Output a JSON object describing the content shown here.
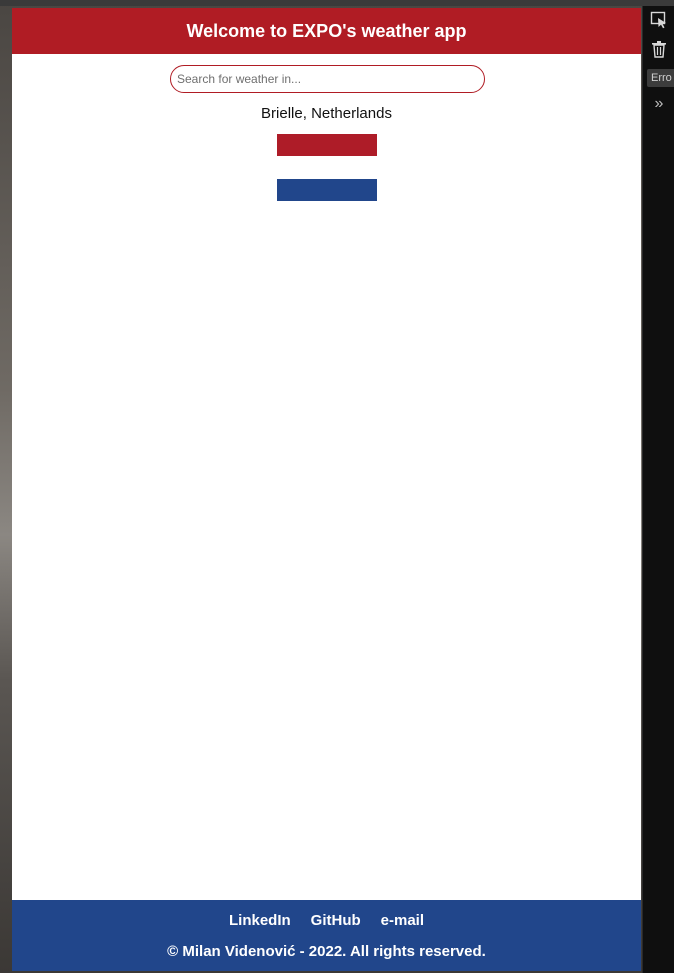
{
  "header": {
    "title": "Welcome to EXPO's weather app"
  },
  "search": {
    "placeholder": "Search for weather in...",
    "value": ""
  },
  "location": {
    "label": "Brielle, Netherlands"
  },
  "flag": {
    "colors": [
      "#ae1c28",
      "#ffffff",
      "#21468b"
    ]
  },
  "footer": {
    "links": [
      "LinkedIn",
      "GitHub",
      "e-mail"
    ],
    "copyright": "© Milan Videnović - 2022. All rights reserved."
  },
  "devtools": {
    "icons": [
      "select-element-icon",
      "trash-icon",
      "chevron-double-right-icon"
    ],
    "error_tab": "Erro"
  },
  "colors": {
    "header_bg": "#b01c24",
    "footer_bg": "#21468b",
    "app_bg": "#ffffff"
  }
}
